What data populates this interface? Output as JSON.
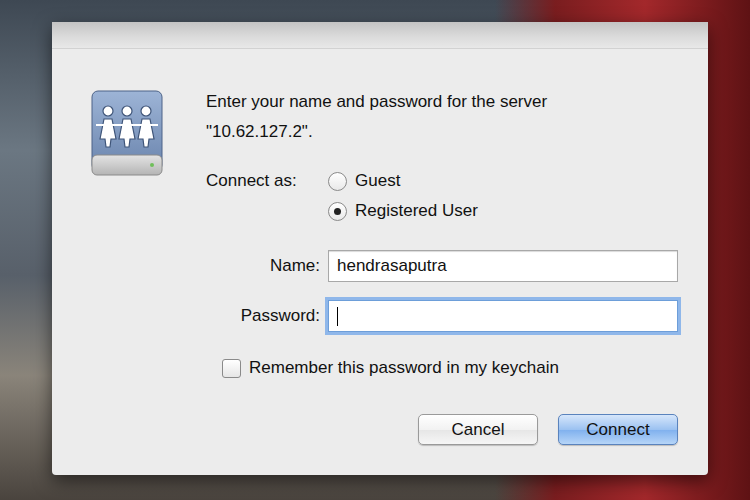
{
  "dialog": {
    "message": "Enter your name and password for the server \"10.62.127.2\".",
    "connect_as": {
      "label": "Connect as:",
      "options": [
        {
          "label": "Guest",
          "selected": false
        },
        {
          "label": "Registered User",
          "selected": true
        }
      ]
    },
    "fields": [
      {
        "label": "Name:",
        "value": "hendrasaputra",
        "focused": false
      },
      {
        "label": "Password:",
        "value": "",
        "focused": true
      }
    ],
    "remember": {
      "label": "Remember this password in my keychain",
      "checked": false
    },
    "buttons": [
      {
        "label": "Cancel",
        "default": false
      },
      {
        "label": "Connect",
        "default": true
      }
    ]
  }
}
